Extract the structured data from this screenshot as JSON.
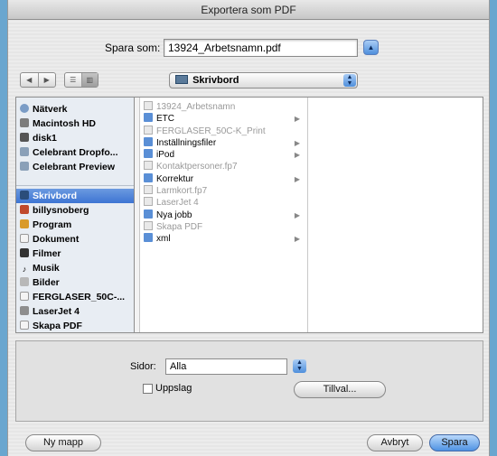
{
  "window": {
    "title": "Exportera som PDF"
  },
  "save": {
    "label": "Spara som:",
    "filename": "13924_Arbetsnamn.pdf"
  },
  "toolbar": {
    "location": "Skrivbord"
  },
  "sidebar": {
    "devices": [
      {
        "label": "Nätverk",
        "icon": "globe-icon"
      },
      {
        "label": "Macintosh HD",
        "icon": "hard-drive-icon"
      },
      {
        "label": "disk1",
        "icon": "disk-icon"
      },
      {
        "label": "Celebrant Dropfo...",
        "icon": "network-drive-icon"
      },
      {
        "label": "Celebrant Preview",
        "icon": "network-drive-icon"
      }
    ],
    "places": [
      {
        "label": "Skrivbord",
        "icon": "desktop-icon",
        "selected": true
      },
      {
        "label": "billysnoberg",
        "icon": "home-icon"
      },
      {
        "label": "Program",
        "icon": "applications-icon"
      },
      {
        "label": "Dokument",
        "icon": "documents-icon"
      },
      {
        "label": "Filmer",
        "icon": "movies-icon"
      },
      {
        "label": "Musik",
        "icon": "music-icon"
      },
      {
        "label": "Bilder",
        "icon": "pictures-icon"
      },
      {
        "label": "FERGLASER_50C-...",
        "icon": "document-icon"
      },
      {
        "label": "LaserJet 4",
        "icon": "printer-icon"
      },
      {
        "label": "Skapa PDF",
        "icon": "document-icon"
      }
    ]
  },
  "files": [
    {
      "name": "13924_Arbetsnamn",
      "kind": "doc",
      "dim": true,
      "arrow": false
    },
    {
      "name": "ETC",
      "kind": "folder",
      "dim": false,
      "arrow": true
    },
    {
      "name": "FERGLASER_50C-K_Print",
      "kind": "doc",
      "dim": true,
      "arrow": false
    },
    {
      "name": "Inställningsfiler",
      "kind": "folder",
      "dim": false,
      "arrow": true
    },
    {
      "name": "iPod",
      "kind": "folder",
      "dim": false,
      "arrow": true
    },
    {
      "name": "Kontaktpersoner.fp7",
      "kind": "doc",
      "dim": true,
      "arrow": false
    },
    {
      "name": "Korrektur",
      "kind": "folder",
      "dim": false,
      "arrow": true
    },
    {
      "name": "Larmkort.fp7",
      "kind": "doc",
      "dim": true,
      "arrow": false
    },
    {
      "name": "LaserJet 4",
      "kind": "doc",
      "dim": true,
      "arrow": false
    },
    {
      "name": "Nya jobb",
      "kind": "folder",
      "dim": false,
      "arrow": true
    },
    {
      "name": "Skapa PDF",
      "kind": "doc",
      "dim": true,
      "arrow": false
    },
    {
      "name": "xml",
      "kind": "folder",
      "dim": false,
      "arrow": true
    }
  ],
  "options": {
    "pages_label": "Sidor:",
    "pages_value": "Alla",
    "spread_label": "Uppslag",
    "settings_button": "Tillval..."
  },
  "footer": {
    "new_folder": "Ny mapp",
    "cancel": "Avbryt",
    "save": "Spara"
  }
}
